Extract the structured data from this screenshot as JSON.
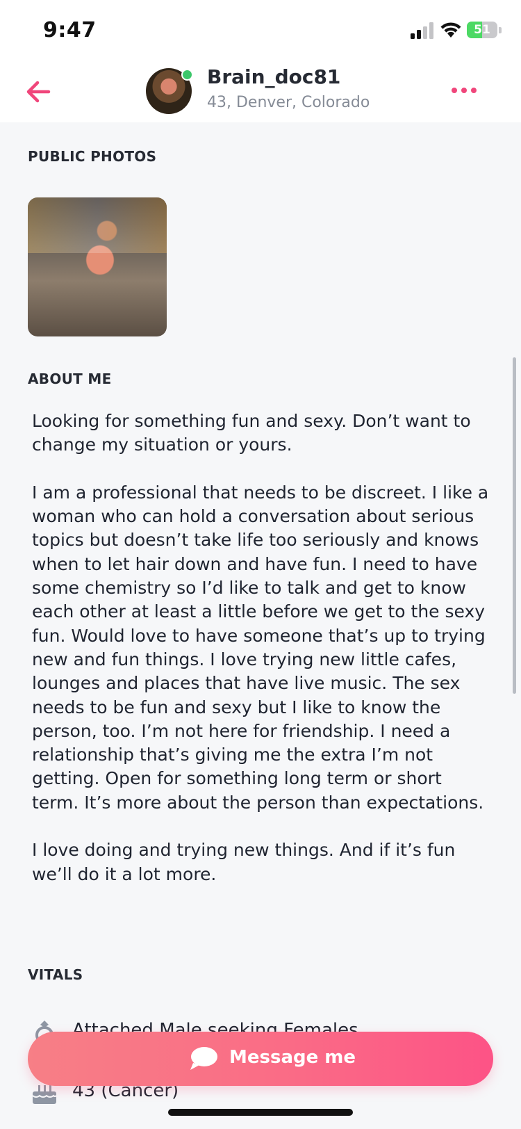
{
  "status_bar": {
    "time": "9:47",
    "battery": "51",
    "battery_level": 0.51
  },
  "header": {
    "back_icon": "arrow-left-icon",
    "username": "Brain_doc81",
    "location": "43, Denver, Colorado",
    "online": true,
    "more_icon": "more-dots-icon",
    "accent_color": "#f0467b"
  },
  "sections": {
    "photos_title": "PUBLIC PHOTOS",
    "about_title": "ABOUT ME",
    "vitals_title": "VITALS"
  },
  "about": {
    "text": "Looking for something fun and sexy. Don’t want to change my situation or yours.\n\nI am a professional that needs to be discreet. I like a woman who can hold a conversation about serious topics but doesn’t take life too seriously and knows when to let hair down and have fun. I need to have some chemistry so I’d like to talk and get to know each other at least a little before we get to the sexy fun. Would love to have someone that’s up to trying new and fun things. I love trying new little cafes, lounges and places that have live music. The sex needs to be fun and sexy but I like to know the person, too. I’m not here for friendship. I need a relationship that’s giving me the extra I’m not getting. Open for something long term or short term. It’s more about the person than expectations.\n\nI love doing and trying new things. And if it’s fun we’ll do it a lot more."
  },
  "vitals": [
    {
      "icon": "ring-icon",
      "text": "Attached Male seeking Females"
    },
    {
      "icon": "birthday-cake-icon",
      "text": "43 (Cancer)"
    }
  ],
  "message_button": {
    "label": "Message me",
    "icon": "chat-bubble-icon"
  }
}
